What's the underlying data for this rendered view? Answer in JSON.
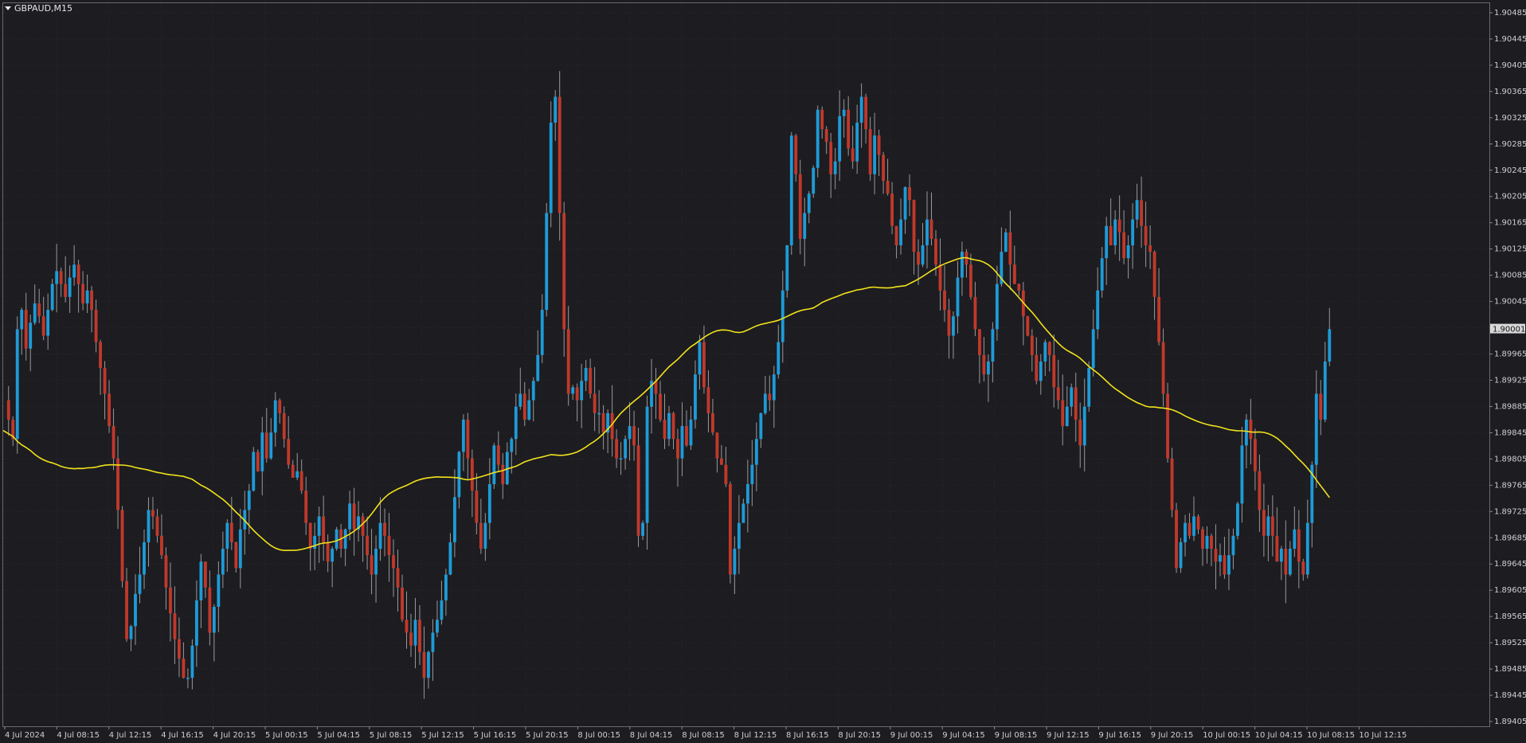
{
  "window": {
    "symbol_label": "GBPAUD,M15"
  },
  "colors": {
    "background": "#1c1c21",
    "bull": "#1e9bd7",
    "bear": "#c0392b",
    "ma": "#f2e21a",
    "grid": "#2a2a30",
    "axis_text": "#d0d0d0"
  },
  "current_price": "1.90001",
  "chart_data": {
    "type": "candlestick",
    "title": "GBPAUD,M15",
    "ylim": [
      1.89385,
      1.90505
    ],
    "price_ticks": [
      "1.90485",
      "1.90445",
      "1.90405",
      "1.90365",
      "1.90325",
      "1.90285",
      "1.90245",
      "1.90205",
      "1.90165",
      "1.90125",
      "1.90085",
      "1.90045",
      "1.90001",
      "1.89965",
      "1.89925",
      "1.89885",
      "1.89845",
      "1.89805",
      "1.89765",
      "1.89725",
      "1.89685",
      "1.89645",
      "1.89605",
      "1.89565",
      "1.89525",
      "1.89485",
      "1.89445",
      "1.89405"
    ],
    "time_ticks": [
      "4 Jul 2024",
      "4 Jul 08:15",
      "4 Jul 12:15",
      "4 Jul 16:15",
      "4 Jul 20:15",
      "5 Jul 00:15",
      "5 Jul 04:15",
      "5 Jul 08:15",
      "5 Jul 12:15",
      "5 Jul 16:15",
      "5 Jul 20:15",
      "8 Jul 00:15",
      "8 Jul 04:15",
      "8 Jul 08:15",
      "8 Jul 12:15",
      "8 Jul 16:15",
      "8 Jul 20:15",
      "9 Jul 00:15",
      "9 Jul 04:15",
      "9 Jul 08:15",
      "9 Jul 12:15",
      "9 Jul 16:15",
      "9 Jul 20:15",
      "10 Jul 00:15",
      "10 Jul 04:15",
      "10 Jul 08:15",
      "10 Jul 12:15"
    ],
    "close_path": [
      1.8986,
      1.8983,
      1.9,
      1.9003,
      1.8997,
      1.9001,
      1.9004,
      1.9002,
      1.8999,
      1.9003,
      1.9007,
      1.9009,
      1.9007,
      1.9005,
      1.9008,
      1.901,
      1.9007,
      1.9004,
      1.9006,
      1.9003,
      1.8998,
      1.8994,
      1.899,
      1.8985,
      1.898,
      1.8972,
      1.8961,
      1.8952,
      1.8954,
      1.8959,
      1.8962,
      1.8967,
      1.8972,
      1.8971,
      1.8968,
      1.8965,
      1.896,
      1.8956,
      1.8952,
      1.8949,
      1.8946,
      1.8946,
      1.8951,
      1.8958,
      1.8964,
      1.896,
      1.8953,
      1.8957,
      1.8962,
      1.8966,
      1.897,
      1.8967,
      1.8963,
      1.8969,
      1.8972,
      1.8975,
      1.8981,
      1.8978,
      1.8984,
      1.898,
      1.8984,
      1.8989,
      1.8987,
      1.8983,
      1.8979,
      1.8977,
      1.8978,
      1.8975,
      1.897,
      1.8966,
      1.8968,
      1.8971,
      1.8967,
      1.8964,
      1.8966,
      1.8969,
      1.8966,
      1.8969,
      1.8973,
      1.8969,
      1.8971,
      1.8968,
      1.8965,
      1.8962,
      1.8966,
      1.897,
      1.8968,
      1.8965,
      1.8963,
      1.896,
      1.8955,
      1.8953,
      1.8951,
      1.8955,
      1.895,
      1.8946,
      1.895,
      1.8953,
      1.8955,
      1.8958,
      1.8962,
      1.8967,
      1.8974,
      1.8981,
      1.8986,
      1.898,
      1.8975,
      1.897,
      1.8966,
      1.897,
      1.8976,
      1.8982,
      1.8979,
      1.8976,
      1.8981,
      1.8983,
      1.8988,
      1.899,
      1.8986,
      1.8989,
      1.8992,
      1.8996,
      1.9003,
      1.9018,
      1.9032,
      1.9036,
      1.9018,
      1.9,
      1.899,
      1.8991,
      1.8989,
      1.8992,
      1.8994,
      1.899,
      1.8987,
      1.8987,
      1.8984,
      1.8987,
      1.8983,
      1.898,
      1.898,
      1.8983,
      1.8985,
      1.8982,
      1.8968,
      1.897,
      1.8988,
      1.8992,
      1.899,
      1.8986,
      1.8983,
      1.8987,
      1.8983,
      1.898,
      1.8985,
      1.8982,
      1.8986,
      1.8993,
      1.8998,
      1.8991,
      1.8987,
      1.8984,
      1.898,
      1.8979,
      1.8976,
      1.8962,
      1.8966,
      1.897,
      1.8973,
      1.8976,
      1.8979,
      1.8983,
      1.8987,
      1.899,
      1.8989,
      1.8993,
      1.8998,
      1.9006,
      1.9013,
      1.903,
      1.9024,
      1.9014,
      1.9018,
      1.9021,
      1.9025,
      1.9034,
      1.9031,
      1.9029,
      1.9024,
      1.9026,
      1.9033,
      1.9034,
      1.9028,
      1.9026,
      1.9032,
      1.9036,
      1.9031,
      1.9024,
      1.903,
      1.9027,
      1.9023,
      1.9021,
      1.9016,
      1.9013,
      1.9017,
      1.9022,
      1.902,
      1.9012,
      1.901,
      1.9013,
      1.9017,
      1.9014,
      1.901,
      1.9006,
      1.9003,
      1.8999,
      1.9002,
      1.9008,
      1.9012,
      1.901,
      1.9005,
      1.9,
      1.8996,
      1.8993,
      1.8995,
      1.9,
      1.9007,
      1.9012,
      1.9015,
      1.901,
      1.9007,
      1.9006,
      1.9002,
      1.8999,
      1.8996,
      1.8992,
      1.8995,
      1.8998,
      1.8996,
      1.8991,
      1.8989,
      1.8985,
      1.8988,
      1.8991,
      1.8986,
      1.8982,
      1.8988,
      1.8994,
      1.9,
      1.9006,
      1.9011,
      1.9016,
      1.9013,
      1.9017,
      1.9015,
      1.9011,
      1.9013,
      1.9017,
      1.902,
      1.9016,
      1.9013,
      1.9012,
      1.9005,
      1.8998,
      1.899,
      1.898,
      1.8972,
      1.8963,
      1.8967,
      1.897,
      1.8968,
      1.8971,
      1.8969,
      1.8966,
      1.8968,
      1.8966,
      1.8964,
      1.8965,
      1.8962,
      1.8965,
      1.8968,
      1.8973,
      1.8982,
      1.8986,
      1.8983,
      1.8978,
      1.8972,
      1.8968,
      1.8971,
      1.8968,
      1.8964,
      1.8966,
      1.8962,
      1.8966,
      1.8969,
      1.8964,
      1.8962,
      1.897,
      1.8979,
      1.899,
      1.8986,
      1.8995,
      1.9
    ],
    "ma_period": 200
  }
}
